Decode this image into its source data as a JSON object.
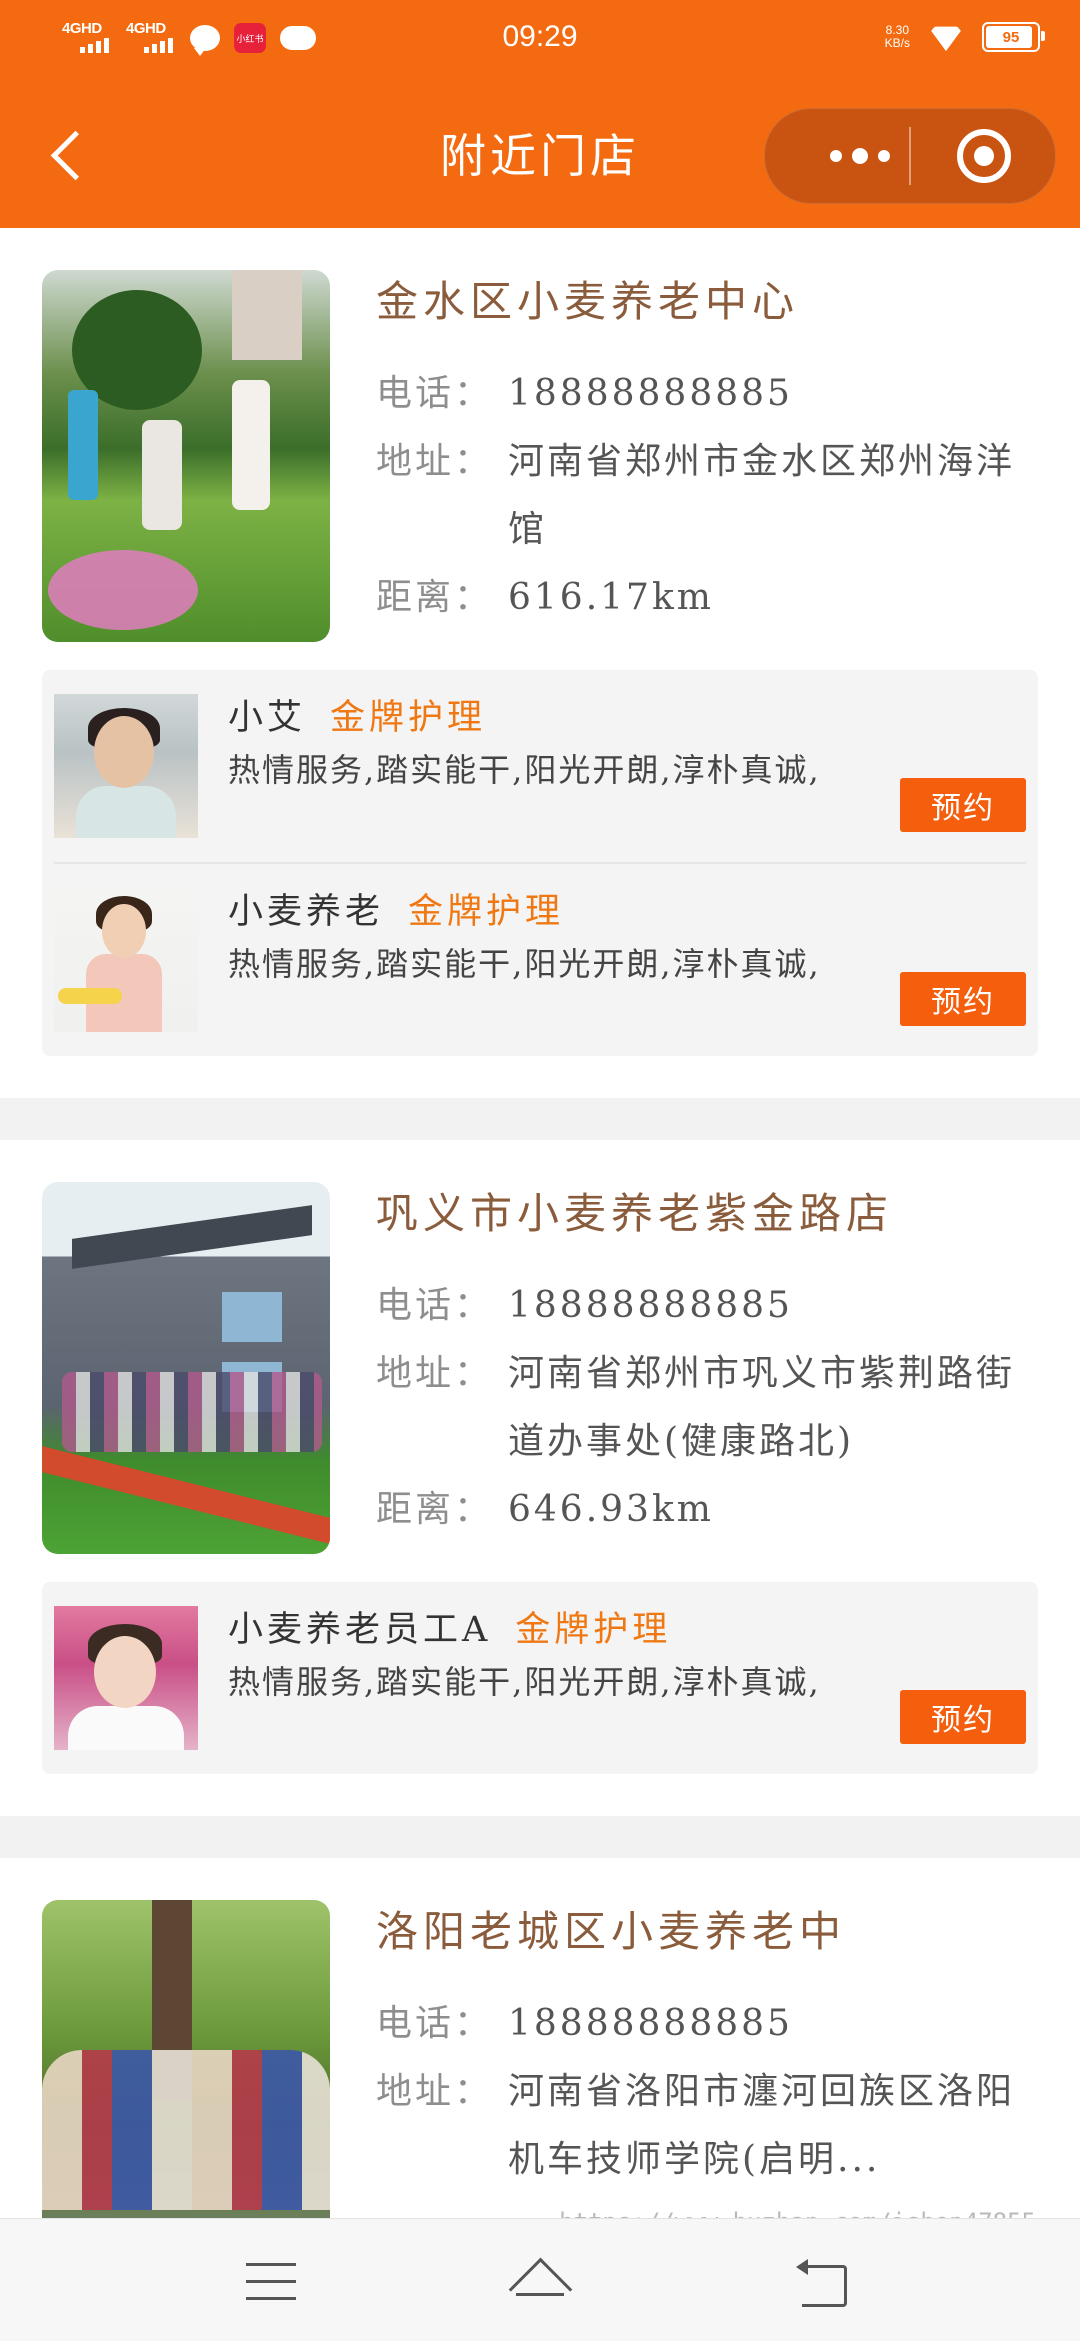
{
  "status_bar": {
    "signal1": "4GHD",
    "signal2": "4GHD",
    "app_badge": "小红书",
    "time": "09:29",
    "net_speed": "8.30",
    "net_unit": "KB/s",
    "battery": "95",
    "battery_level": 0.95
  },
  "nav": {
    "title": "附近门店"
  },
  "labels": {
    "phone": "电话：",
    "address": "地址：",
    "distance": "距离：",
    "reserve": "预约"
  },
  "stores": [
    {
      "name": "金水区小麦养老中心",
      "phone": "18888888885",
      "address": "河南省郑州市金水区郑州海洋馆",
      "distance": "616.17km",
      "staff": [
        {
          "name": "小艾",
          "tag": "金牌护理",
          "desc": "热情服务,踏实能干,阳光开朗,淳朴真诚,"
        },
        {
          "name": "小麦养老",
          "tag": "金牌护理",
          "desc": "热情服务,踏实能干,阳光开朗,淳朴真诚,"
        }
      ]
    },
    {
      "name": "巩义市小麦养老紫金路店",
      "phone": "18888888885",
      "address": "河南省郑州市巩义市紫荆路街道办事处(健康路北)",
      "distance": "646.93km",
      "staff": [
        {
          "name": "小麦养老员工A",
          "tag": "金牌护理",
          "desc": "热情服务,踏实能干,阳光开朗,淳朴真诚,"
        }
      ]
    },
    {
      "name": "洛阳老城区小麦养老中",
      "phone": "18888888885",
      "address": "河南省洛阳市瀍河回族区洛阳机车技师学院(启明...",
      "distance": ""
    }
  ],
  "watermark": "https://www.huzhan.com/ishop47855",
  "colors": {
    "brand": "#f46a10",
    "button": "#f55e0c",
    "tag": "#f07813",
    "store_name": "#8a5c3c"
  },
  "icons": {
    "back": "chevron-left-icon",
    "more": "more-dots-icon",
    "close": "target-circle-icon",
    "menu": "menu-icon",
    "home": "home-icon",
    "return": "return-icon"
  }
}
